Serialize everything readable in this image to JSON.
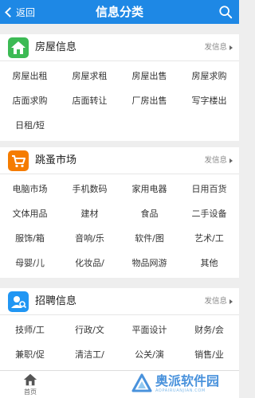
{
  "header": {
    "back_label": "返回",
    "title": "信息分类"
  },
  "colors": {
    "header_bg": "#1e88e5",
    "housing_icon": "#3cba54",
    "flea_icon": "#f57c00",
    "jobs_icon": "#2196f3"
  },
  "sections": [
    {
      "title": "房屋信息",
      "icon": "house-icon",
      "post_label": "发信息",
      "items": [
        "房屋出租",
        "房屋求租",
        "房屋出售",
        "房屋求购",
        "店面求购",
        "店面转让",
        "厂房出售",
        "写字楼出",
        "日租/短"
      ]
    },
    {
      "title": "跳蚤市场",
      "icon": "cart-icon",
      "post_label": "发信息",
      "items": [
        "电脑市场",
        "手机数码",
        "家用电器",
        "日用百货",
        "文体用品",
        "建材",
        "食品",
        "二手设备",
        "服饰/箱",
        "音响/乐",
        "软件/图",
        "艺术/工",
        "母婴/儿",
        "化妆品/",
        "物品网游",
        "其他"
      ]
    },
    {
      "title": "招聘信息",
      "icon": "person-search-icon",
      "post_label": "发信息",
      "items": [
        "技师/工",
        "行政/文",
        "平面设计",
        "财务/会",
        "兼职/促",
        "清洁工/",
        "公关/演",
        "销售/业"
      ]
    }
  ],
  "bottom_nav": {
    "home_label": "首页"
  },
  "watermark": {
    "cn": "奥派软件园",
    "en": "AOPAIRUANJIAN.COM"
  }
}
